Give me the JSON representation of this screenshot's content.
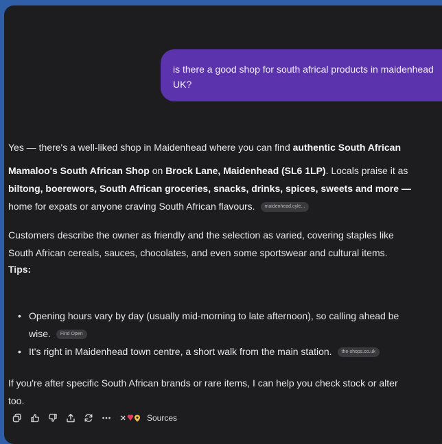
{
  "user_message": {
    "line1": "is there a good shop for south africal products in maidenhead",
    "line2": "UK?"
  },
  "assistant": {
    "p1_pre": "Yes — there's a well-liked shop in Maidenhead where you can find ",
    "p1_bold": "authentic South African",
    "p2_l1_b1": "Mamaloo's South African Shop",
    "p2_l1_t1": " on ",
    "p2_l1_b2": "Brock Lane, Maidenhead (SL6 1LP)",
    "p2_l1_t2": ". Locals praise it as",
    "p2_l2_bold": "biltong, boerewors, South African groceries, snacks, drinks, spices, sweets and more —",
    "p2_l3": "home for expats or anyone craving South African flavours.",
    "chip1": "maidenhead.cyle...",
    "p3_l1": "Customers describe the owner as friendly and the selection as varied, covering staples like",
    "p3_l2": "South African cereals, sauces, chocolates, and even some sportswear and cultural items.",
    "tips_heading": "Tips:",
    "bullet1_l1": "Opening hours vary by day (usually mid-morning to late afternoon), so calling ahead be",
    "bullet1_l2": "wise.",
    "chip2": "Find Open",
    "bullet2": "It's right in Maidenhead town centre, a short walk from the main station.",
    "chip3": "the-shops.co.uk",
    "p4_l1": "If you're after specific South African brands or rare items, I can help you check stock or alter",
    "p4_l2": "too."
  },
  "toolbar": {
    "icons": [
      "copy-icon",
      "thumbs-up-icon",
      "thumbs-down-icon",
      "share-icon",
      "regenerate-icon",
      "more-icon"
    ],
    "sources_label": "Sources"
  },
  "colors": {
    "background": "#2f5fa8",
    "window": "#1d1d1f",
    "user_bubble": "#5b34ad"
  }
}
